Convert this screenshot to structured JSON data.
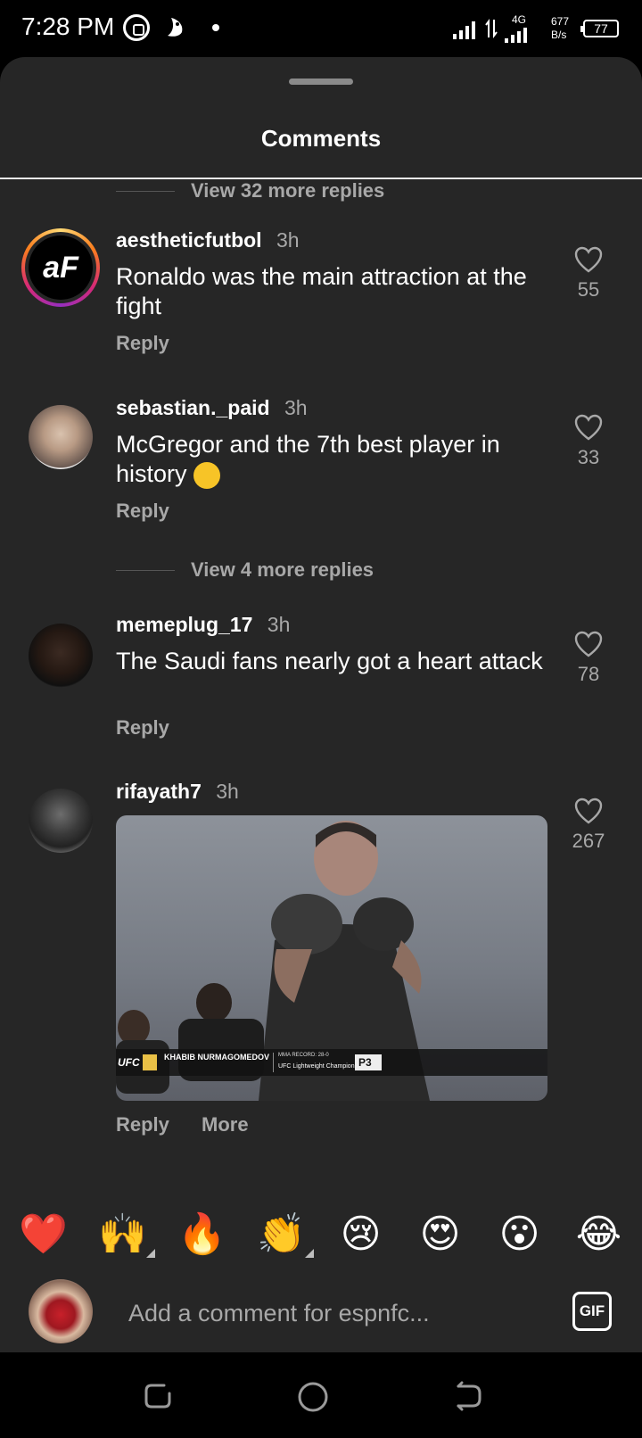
{
  "status_bar": {
    "time": "7:28 PM",
    "network": "4G",
    "speed_value": "677",
    "speed_unit": "B/s",
    "battery": "77"
  },
  "sheet": {
    "title": "Comments"
  },
  "view_replies_top": "View 32 more replies",
  "view_replies_mid": "View 4 more replies",
  "comments": [
    {
      "username": "aestheticfutbol",
      "time": "3h",
      "text": "Ronaldo was the main attraction at the fight",
      "likes": "55",
      "reply": "Reply",
      "avatar_label": "aF"
    },
    {
      "username": "sebastian._paid",
      "time": "3h",
      "text": "McGregor and the 7th best player in history",
      "likes": "33",
      "reply": "Reply"
    },
    {
      "username": "memeplug_17",
      "time": "3h",
      "text": "The Saudi fans nearly got a heart attack",
      "likes": "78",
      "reply": "Reply"
    },
    {
      "username": "rifayath7",
      "time": "3h",
      "likes": "267",
      "reply": "Reply",
      "more": "More",
      "gif_overlay": {
        "league": "UFC",
        "fighter": "KHABIB NURMAGOMEDOV",
        "record": "MMA RECORD: 28-0",
        "title": "UFC Lightweight Champion",
        "sponsor": "P3"
      }
    }
  ],
  "emoji_bar": [
    "❤️",
    "🙌",
    "🔥",
    "👏",
    "😢",
    "😍",
    "😮",
    "😂"
  ],
  "composer": {
    "placeholder": "Add a comment for espnfc...",
    "gif_label": "GIF"
  },
  "colors": {
    "sheet_bg": "#262626",
    "secondary_text": "#a8a8a8",
    "primary_text": "#ffffff"
  }
}
